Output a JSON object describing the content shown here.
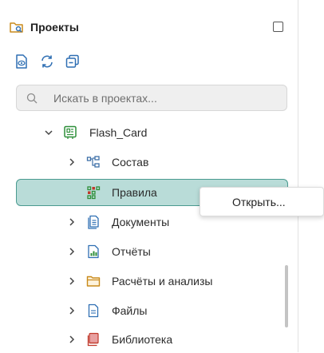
{
  "header": {
    "title": "Проекты",
    "icon": "folder-search-icon"
  },
  "toolbar": {
    "buttons": [
      "view-document-icon",
      "refresh-icon",
      "collapse-all-icon"
    ]
  },
  "search": {
    "placeholder": "Искать в проектах...",
    "value": ""
  },
  "tree": {
    "project": {
      "label": "Flash_Card",
      "icon": "card-icon",
      "expanded": true
    },
    "items": [
      {
        "label": "Состав",
        "icon": "structure-icon",
        "expandable": true
      },
      {
        "label": "Правила",
        "icon": "rules-icon",
        "expandable": false,
        "selected": true
      },
      {
        "label": "Документы",
        "icon": "documents-icon",
        "expandable": true
      },
      {
        "label": "Отчёты",
        "icon": "reports-icon",
        "expandable": true
      },
      {
        "label": "Расчёты и анализы",
        "icon": "folder-icon",
        "expandable": true
      },
      {
        "label": "Файлы",
        "icon": "file-icon",
        "expandable": true
      },
      {
        "label": "Библиотека",
        "icon": "library-icon",
        "expandable": true
      }
    ]
  },
  "context_menu": {
    "items": [
      "Открыть..."
    ]
  },
  "colors": {
    "accent": "#2f9e90",
    "selected_bg": "#b9dcd8",
    "selected_border": "#4a9a90",
    "search_bg": "#efefef"
  }
}
